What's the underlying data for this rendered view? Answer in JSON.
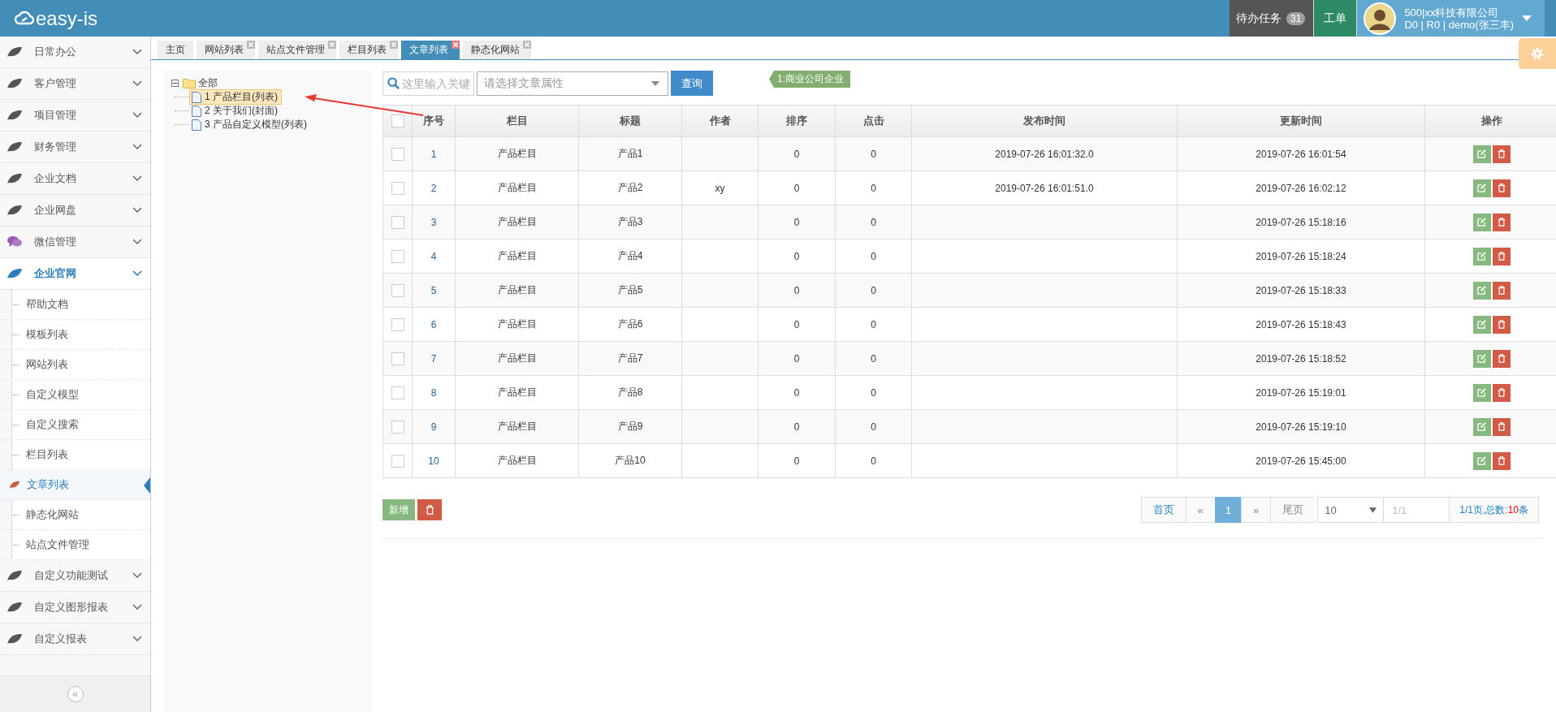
{
  "header": {
    "logo": "easy-is",
    "todo": {
      "label": "待办任务",
      "count": "31"
    },
    "workorder": "工单",
    "user": {
      "company": "500|xx科技有限公司",
      "account": "D0 | R0 | demo(张三丰)"
    }
  },
  "sidebar": {
    "items": [
      {
        "label": "日常办公",
        "kind": "leaf",
        "expanded": false
      },
      {
        "label": "客户管理",
        "kind": "leaf",
        "expanded": false
      },
      {
        "label": "项目管理",
        "kind": "leaf",
        "expanded": false
      },
      {
        "label": "财务管理",
        "kind": "leaf",
        "expanded": false
      },
      {
        "label": "企业文档",
        "kind": "leaf",
        "expanded": false
      },
      {
        "label": "企业网盘",
        "kind": "leaf",
        "expanded": false
      },
      {
        "label": "微信管理",
        "kind": "chat",
        "expanded": false
      },
      {
        "label": "企业官网",
        "kind": "leaf",
        "expanded": true,
        "children": [
          {
            "label": "帮助文档",
            "selected": false
          },
          {
            "label": "模板列表",
            "selected": false
          },
          {
            "label": "网站列表",
            "selected": false
          },
          {
            "label": "自定义模型",
            "selected": false
          },
          {
            "label": "自定义搜索",
            "selected": false
          },
          {
            "label": "栏目列表",
            "selected": false
          },
          {
            "label": "文章列表",
            "selected": true
          },
          {
            "label": "静态化网站",
            "selected": false
          },
          {
            "label": "站点文件管理",
            "selected": false
          }
        ]
      },
      {
        "label": "自定义功能测试",
        "kind": "leaf",
        "expanded": false
      },
      {
        "label": "自定义图形报表",
        "kind": "leaf",
        "expanded": false
      },
      {
        "label": "自定义报表",
        "kind": "leaf",
        "expanded": false
      }
    ],
    "collapse": "«"
  },
  "tabs": [
    {
      "label": "主页",
      "selected": false,
      "closable": false
    },
    {
      "label": "网站列表",
      "selected": false,
      "closable": true
    },
    {
      "label": "站点文件管理",
      "selected": false,
      "closable": true
    },
    {
      "label": "栏目列表",
      "selected": false,
      "closable": true
    },
    {
      "label": "文章列表",
      "selected": true,
      "closable": true
    },
    {
      "label": "静态化网站",
      "selected": false,
      "closable": true
    }
  ],
  "tree": {
    "label": "全部",
    "expanded": true,
    "children": [
      {
        "label": "1 产品栏目(列表)",
        "selected": true
      },
      {
        "label": "2 关于我们(封面)",
        "selected": false
      },
      {
        "label": "3 产品自定义模型(列表)",
        "selected": false
      }
    ]
  },
  "toolbar": {
    "search": {
      "placeholder": "这里输入关键"
    },
    "attribute": {
      "placeholder": "请选择文章属性"
    },
    "query": "查询",
    "tag": "1:商业公司企业"
  },
  "table": {
    "select_all": false,
    "columns": [
      "序号",
      "栏目",
      "标题",
      "作者",
      "排序",
      "点击",
      "发布时间",
      "更新时间",
      "操作"
    ],
    "rows": [
      {
        "checked": false,
        "cells": [
          "1",
          "产品栏目",
          "产品1",
          "",
          "0",
          "0",
          "2019-07-26 16:01:32.0",
          "2019-07-26 16:01:54"
        ]
      },
      {
        "checked": false,
        "cells": [
          "2",
          "产品栏目",
          "产品2",
          "xy",
          "0",
          "0",
          "2019-07-26 16:01:51.0",
          "2019-07-26 16:02:12"
        ]
      },
      {
        "checked": false,
        "cells": [
          "3",
          "产品栏目",
          "产品3",
          "",
          "0",
          "0",
          "",
          "2019-07-26 15:18:16"
        ]
      },
      {
        "checked": false,
        "cells": [
          "4",
          "产品栏目",
          "产品4",
          "",
          "0",
          "0",
          "",
          "2019-07-26 15:18:24"
        ]
      },
      {
        "checked": false,
        "cells": [
          "5",
          "产品栏目",
          "产品5",
          "",
          "0",
          "0",
          "",
          "2019-07-26 15:18:33"
        ]
      },
      {
        "checked": false,
        "cells": [
          "6",
          "产品栏目",
          "产品6",
          "",
          "0",
          "0",
          "",
          "2019-07-26 15:18:43"
        ]
      },
      {
        "checked": false,
        "cells": [
          "7",
          "产品栏目",
          "产品7",
          "",
          "0",
          "0",
          "",
          "2019-07-26 15:18:52"
        ]
      },
      {
        "checked": false,
        "cells": [
          "8",
          "产品栏目",
          "产品8",
          "",
          "0",
          "0",
          "",
          "2019-07-26 15:19:01"
        ]
      },
      {
        "checked": false,
        "cells": [
          "9",
          "产品栏目",
          "产品9",
          "",
          "0",
          "0",
          "",
          "2019-07-26 15:19:10"
        ]
      },
      {
        "checked": false,
        "cells": [
          "10",
          "产品栏目",
          "产品10",
          "",
          "0",
          "0",
          "",
          "2019-07-26 15:45:00"
        ]
      }
    ]
  },
  "actions": {
    "add": "新增"
  },
  "pagination": {
    "first": "首页",
    "prev": "«",
    "pages": [
      {
        "label": "1",
        "selected": true
      }
    ],
    "next": "»",
    "last": "尾页",
    "page_size": "10",
    "page_input": {
      "placeholder": "1/1"
    },
    "summary": "1/1页,总数:",
    "total": "10",
    "unit": "条"
  }
}
